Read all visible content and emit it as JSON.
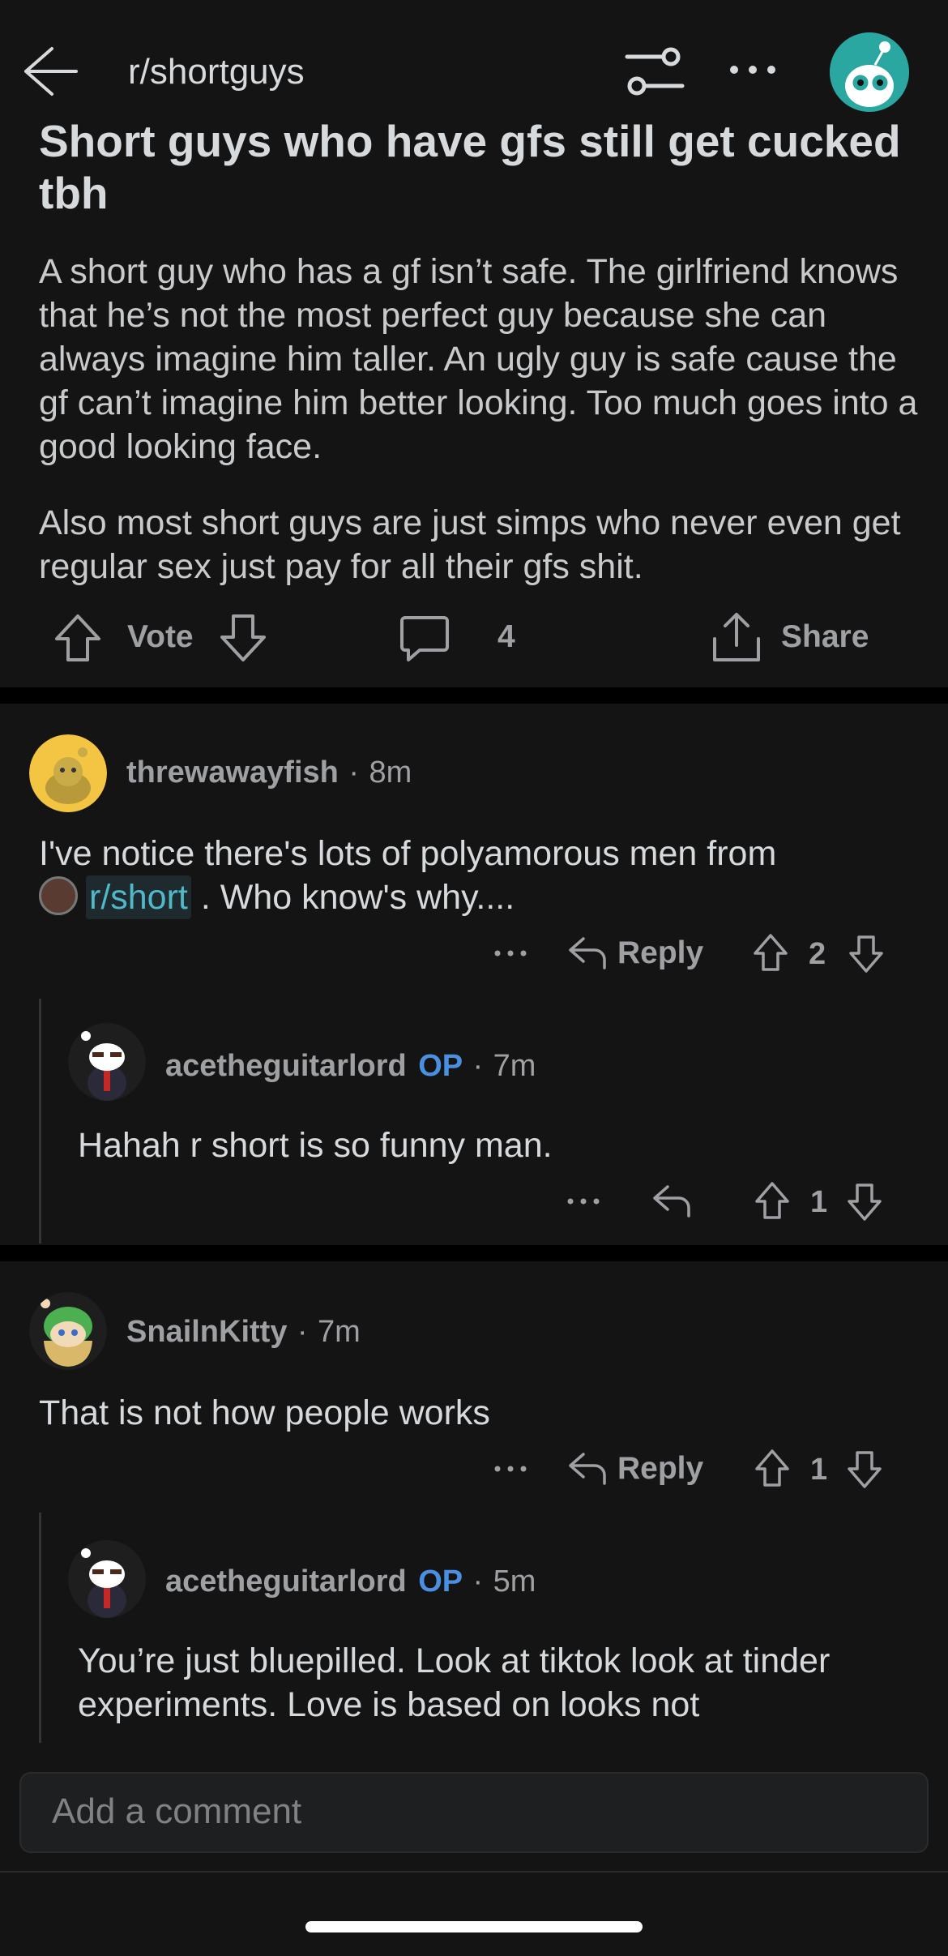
{
  "header": {
    "subreddit": "r/shortguys"
  },
  "post": {
    "title": "Short guys who have gfs still get cucked tbh",
    "body_p1": "A short guy who has a gf isn’t safe. The girlfriend knows that he’s not the most perfect guy because she can always imagine him taller. An ugly guy is safe cause the gf can’t imagine him better looking. Too much goes into a good looking face.",
    "body_p2": "Also most short guys are just simps who never even get regular sex just pay for all their gfs shit.",
    "vote_label": "Vote",
    "comment_count": "4",
    "share_label": "Share"
  },
  "comments": [
    {
      "username": "threwawayfish",
      "time": "8m",
      "text_before": "I've notice there's lots of polyamorous men from",
      "sub_link": "r/short",
      "text_after": ". Who know's why....",
      "reply_label": "Reply",
      "score": "2",
      "replies": [
        {
          "username": "acetheguitarlord",
          "op": "OP",
          "time": "7m",
          "text": "Hahah r short is so funny man.",
          "score": "1"
        }
      ]
    },
    {
      "username": "SnailnKitty",
      "time": "7m",
      "text": "That is not how people works",
      "reply_label": "Reply",
      "score": "1",
      "replies": [
        {
          "username": "acetheguitarlord",
          "op": "OP",
          "time": "5m",
          "text": "You’re just bluepilled. Look at tiktok look at tinder experiments. Love is based on looks not"
        }
      ]
    }
  ],
  "footer": {
    "add_comment_placeholder": "Add a comment"
  },
  "separator": "·"
}
